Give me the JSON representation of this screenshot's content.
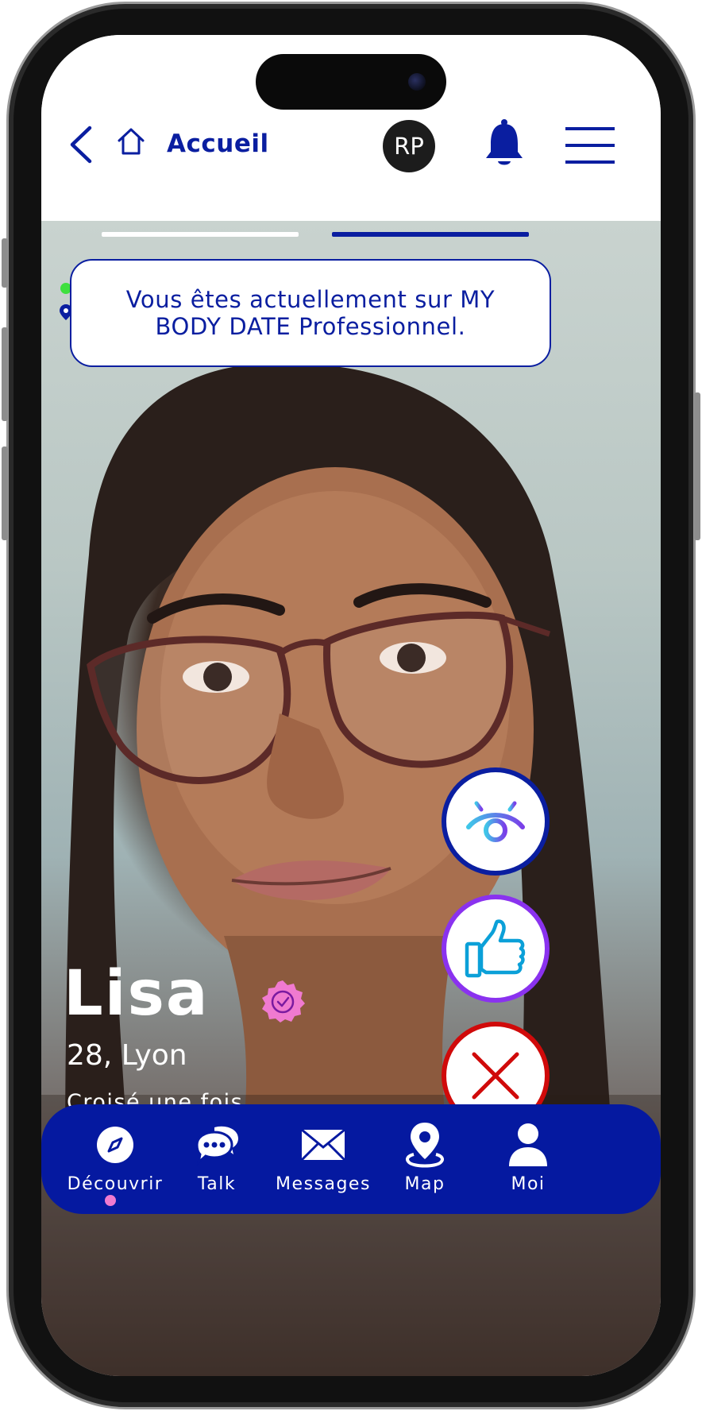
{
  "header": {
    "back_icon": "chevron-left-icon",
    "home_icon": "home-icon",
    "title": "Accueil",
    "avatar_initials": "RP",
    "bell_icon": "bell-icon",
    "menu_icon": "hamburger-menu-icon"
  },
  "stories": {
    "segments": 2,
    "active_index": 1
  },
  "banner": {
    "text": "Vous êtes actuellement sur MY BODY DATE Professionnel."
  },
  "profile": {
    "name": "Lisa",
    "age_city": "28, Lyon",
    "encounter": "Croisé une fois",
    "verified_icon": "verified-badge-icon",
    "online": true
  },
  "actions": {
    "view_icon": "eye-icon",
    "like_icon": "thumbs-up-icon",
    "dismiss_icon": "close-x-icon"
  },
  "bottom_nav": {
    "items": [
      {
        "label": "Découvrir",
        "icon": "compass-icon",
        "active": true
      },
      {
        "label": "Talk",
        "icon": "chat-bubbles-icon",
        "active": false
      },
      {
        "label": "Messages",
        "icon": "envelope-icon",
        "active": false
      },
      {
        "label": "Map",
        "icon": "map-pin-icon",
        "active": false
      },
      {
        "label": "Moi",
        "icon": "user-icon",
        "active": false
      }
    ]
  },
  "colors": {
    "brand_blue": "#0a1ea0",
    "nav_blue": "#0519a0",
    "like_purple": "#8a32ef",
    "dismiss_red": "#d00a0a",
    "verified_pink": "#f07ad0",
    "online_green": "#3ee03e"
  }
}
